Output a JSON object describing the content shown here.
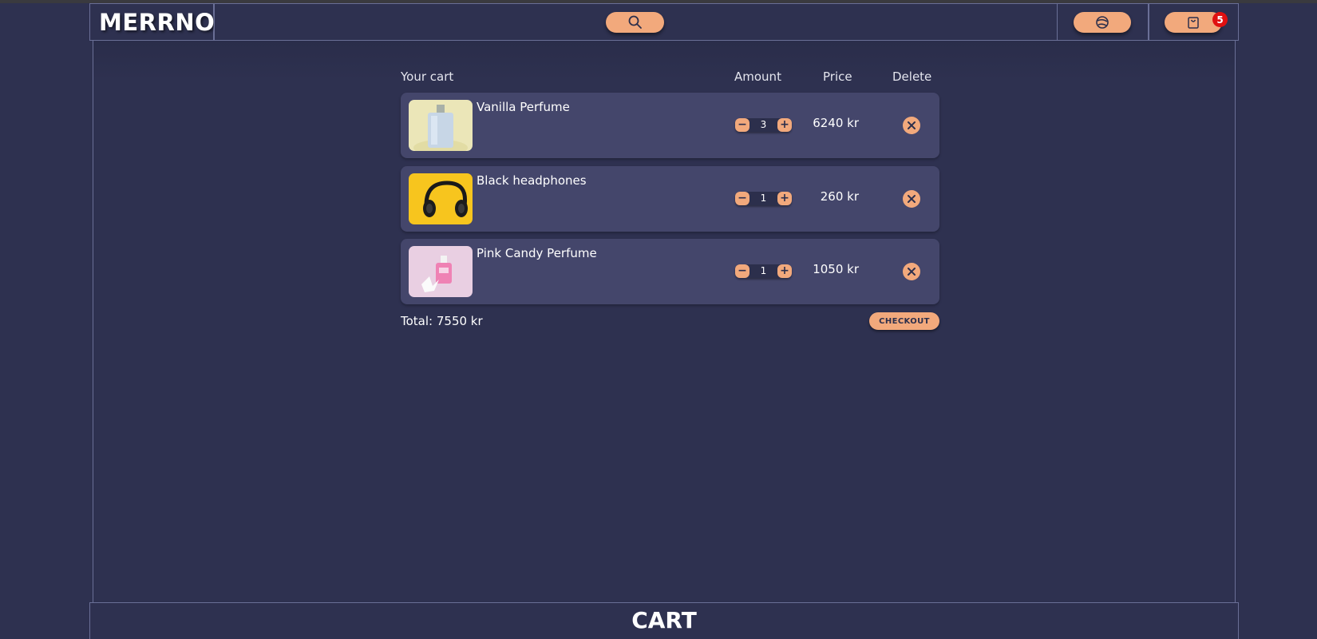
{
  "header": {
    "logo": "MERRNO",
    "search_icon": "search-icon",
    "account_icon": "account-icon",
    "cart_icon": "shopping-bag-icon",
    "cart_count": "5"
  },
  "cart": {
    "columns": {
      "item": "Your cart",
      "amount": "Amount",
      "price": "Price",
      "delete": "Delete"
    },
    "items": [
      {
        "name": "Vanilla Perfume",
        "quantity": "3",
        "price": "6240 kr",
        "image": "vanilla-perfume-bottle"
      },
      {
        "name": "Black headphones",
        "quantity": "1",
        "price": "260 kr",
        "image": "black-headphones"
      },
      {
        "name": "Pink Candy Perfume",
        "quantity": "1",
        "price": "1050 kr",
        "image": "pink-perfume-bottle"
      }
    ],
    "total": "Total: 7550 kr",
    "checkout_label": "CHECKOUT"
  },
  "footer": {
    "title": "CART"
  },
  "colors": {
    "background": "#2e3150",
    "row_background": "#44466b",
    "accent": "#f2a97c",
    "badge": "#e01010",
    "border": "#6a6f96"
  }
}
